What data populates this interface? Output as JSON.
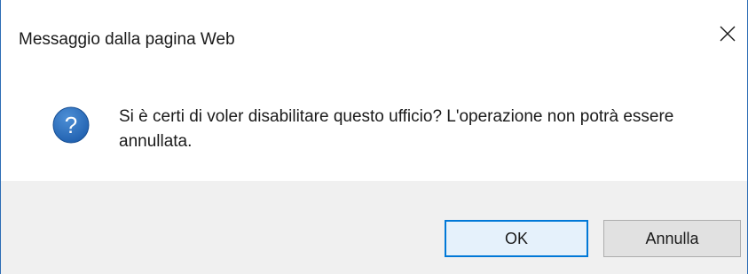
{
  "dialog": {
    "title": "Messaggio dalla pagina Web",
    "close_icon": "close-icon",
    "icon": "question-icon",
    "message": "Si è certi di voler disabilitare questo ufficio? L'operazione non potrà essere annullata.",
    "buttons": {
      "ok_label": "OK",
      "cancel_label": "Annulla"
    }
  },
  "colors": {
    "border": "#2d6db5",
    "footer_bg": "#f0f0f0",
    "ok_border": "#0078d7",
    "ok_bg": "#e5f1fb",
    "cancel_bg": "#e1e1e1",
    "icon_blue": "#1f5fae"
  }
}
